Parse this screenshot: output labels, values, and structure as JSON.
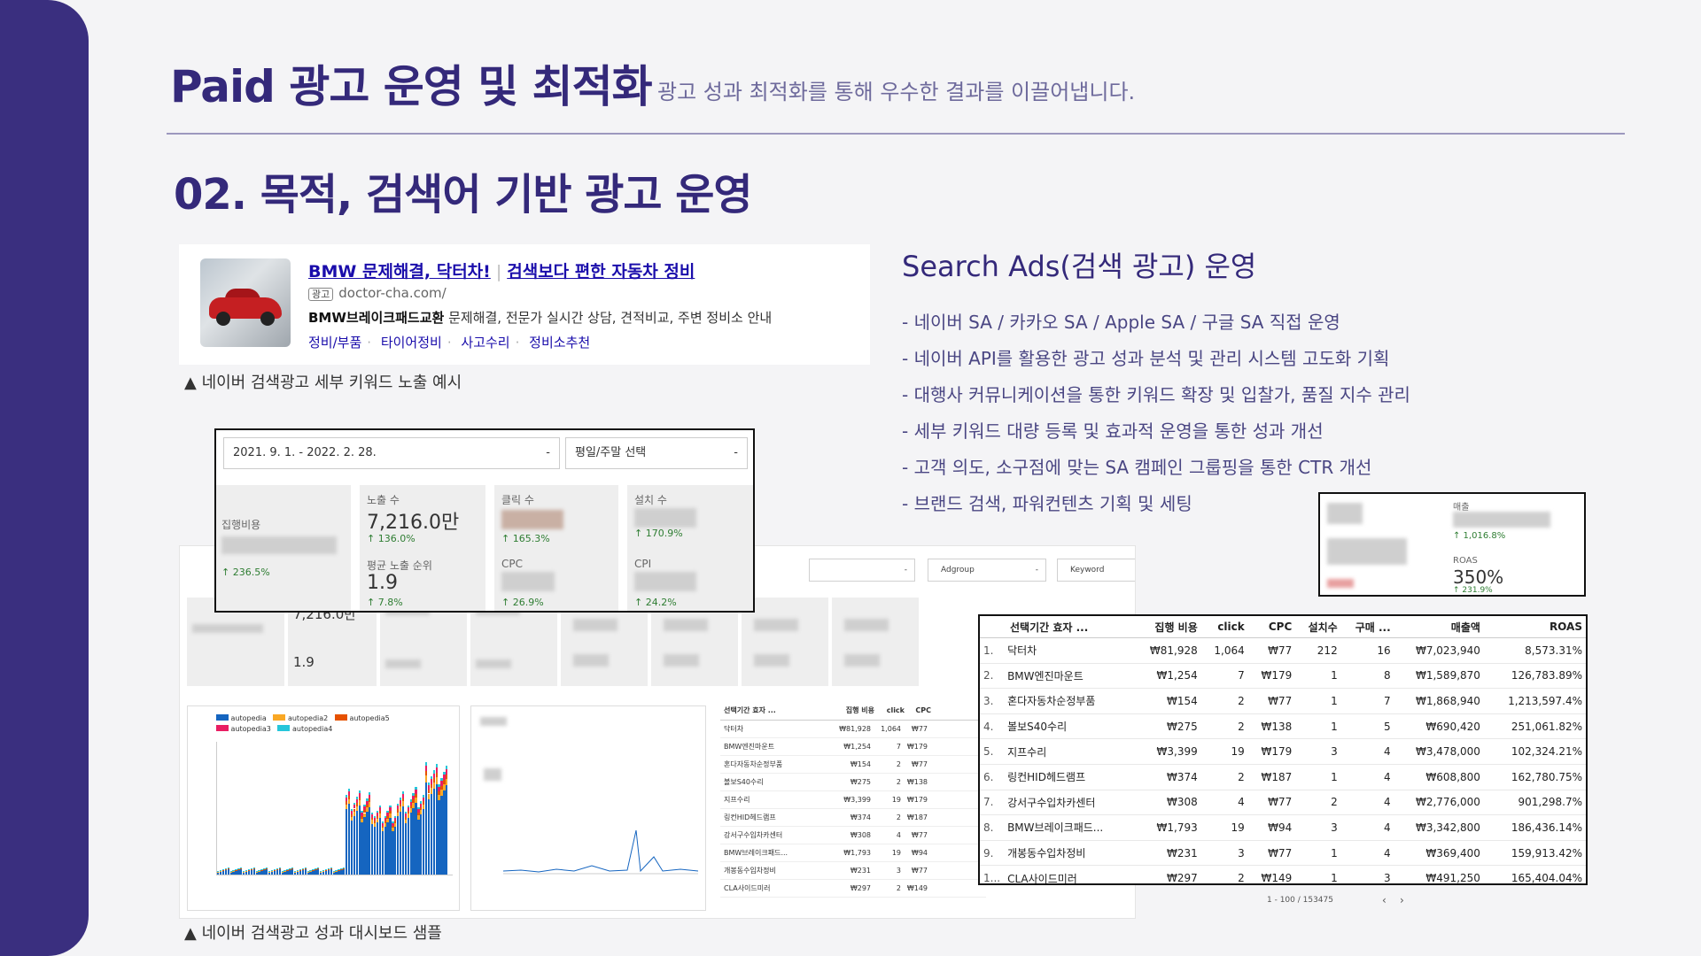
{
  "header": {
    "title": "Paid 광고 운영 및 최적화",
    "subtitle": "광고 성과 최적화를 통해 우수한 결과를 이끌어냅니다."
  },
  "section_title": "02. 목적, 검색어 기반 광고 운영",
  "ad_preview": {
    "title_main": "BMW 문제해결, 닥터차!",
    "title_sub": "검색보다 편한 자동차 정비",
    "ad_tag": "광고",
    "url": "doctor-cha.com/",
    "desc_bold": "BMW브레이크패드교환",
    "desc_rest": " 문제해결, 전문가 실시간 상담, 견적비교, 주변 정비소 안내",
    "links": [
      "정비/부품",
      "타이어정비",
      "사고수리",
      "정비소추천"
    ],
    "caption": "▲ 네이버 검색광고 세부 키워드 노출 예시"
  },
  "search_ads": {
    "heading": "Search Ads(검색 광고) 운영",
    "bullets": [
      "- 네이버 SA / 카카오 SA / Apple SA / 구글 SA 직접 운영",
      "- 네이버 API를 활용한 광고 성과 분석 및 관리 시스템 고도화 기획",
      "- 대행사 커뮤니케이션을 통한 키워드 확장 및 입찰가, 품질 지수 관리",
      "- 세부 키워드 대량 등록 및 효과적 운영을 통한 성과 개선",
      "- 고객 의도, 소구점에 맞는 SA 캠페인 그룹핑을 통한 CTR 개선",
      "- 브랜드 검색, 파워컨텐츠 기획 및 세팅"
    ]
  },
  "kpi_zoom": {
    "date_range": "2021. 9. 1. - 2022. 2. 28.",
    "weekday_select": "평일/주말 선택",
    "cost_label": "집행비용",
    "cost_change": "↑ 236.5%",
    "impr_label": "노출 수",
    "impr_value": "7,216.0만",
    "impr_change": "↑ 136.0%",
    "avg_rank_label": "평균 노출 순위",
    "avg_rank_value": "1.9",
    "avg_rank_change": "↑ 7.8%",
    "click_label": "클릭 수",
    "click_change": "↑ 165.3%",
    "cpc_label": "CPC",
    "cpc_change": "↑ 26.9%",
    "install_label": "설치 수",
    "install_change": "↑ 170.9%",
    "cpi_label": "CPI",
    "cpi_change": "↑ 24.2%"
  },
  "roas_zoom": {
    "sales_label": "매출",
    "sales_change": "↑ 1,016.8%",
    "roas_label": "ROAS",
    "roas_value": "350%",
    "roas_change": "↑ 231.9%"
  },
  "dashboard": {
    "filter_adgroup": "Adgroup",
    "filter_keyword": "Keyword",
    "legend": [
      "autopedia",
      "autopedia2",
      "autopedia5",
      "autopedia3",
      "autopedia4"
    ],
    "legend_colors": [
      "#1565c0",
      "#f9a825",
      "#e65100",
      "#e91e63",
      "#26c6da"
    ],
    "pagination": "1 - 100 / 153475",
    "caption": "▲ 네이버 검색광고 성과 대시보드 샘플",
    "mini_kpi_impr": "7,216.0만",
    "mini_kpi_rank": "1.9"
  },
  "keyword_table": {
    "headers": [
      "선택기간 효자 ...",
      "집행 비용",
      "click",
      "CPC",
      "설치수",
      "구매 ...",
      "매출액",
      "ROAS"
    ],
    "rows": [
      {
        "n": "1.",
        "kw": "닥터차",
        "cost": "₩81,928",
        "click": "1,064",
        "cpc": "₩77",
        "install": "212",
        "buy": "16",
        "sales": "₩7,023,940",
        "roas": "8,573.31%"
      },
      {
        "n": "2.",
        "kw": "BMW엔진마운트",
        "cost": "₩1,254",
        "click": "7",
        "cpc": "₩179",
        "install": "1",
        "buy": "8",
        "sales": "₩1,589,870",
        "roas": "126,783.89%"
      },
      {
        "n": "3.",
        "kw": "혼다자동차순정부품",
        "cost": "₩154",
        "click": "2",
        "cpc": "₩77",
        "install": "1",
        "buy": "7",
        "sales": "₩1,868,940",
        "roas": "1,213,597.4%"
      },
      {
        "n": "4.",
        "kw": "볼보S40수리",
        "cost": "₩275",
        "click": "2",
        "cpc": "₩138",
        "install": "1",
        "buy": "5",
        "sales": "₩690,420",
        "roas": "251,061.82%"
      },
      {
        "n": "5.",
        "kw": "지프수리",
        "cost": "₩3,399",
        "click": "19",
        "cpc": "₩179",
        "install": "3",
        "buy": "4",
        "sales": "₩3,478,000",
        "roas": "102,324.21%"
      },
      {
        "n": "6.",
        "kw": "링컨HID헤드램프",
        "cost": "₩374",
        "click": "2",
        "cpc": "₩187",
        "install": "1",
        "buy": "4",
        "sales": "₩608,800",
        "roas": "162,780.75%"
      },
      {
        "n": "7.",
        "kw": "강서구수입차카센터",
        "cost": "₩308",
        "click": "4",
        "cpc": "₩77",
        "install": "2",
        "buy": "4",
        "sales": "₩2,776,000",
        "roas": "901,298.7%"
      },
      {
        "n": "8.",
        "kw": "BMW브레이크패드...",
        "cost": "₩1,793",
        "click": "19",
        "cpc": "₩94",
        "install": "3",
        "buy": "4",
        "sales": "₩3,342,800",
        "roas": "186,436.14%"
      },
      {
        "n": "9.",
        "kw": "개봉동수입차정비",
        "cost": "₩231",
        "click": "3",
        "cpc": "₩77",
        "install": "1",
        "buy": "4",
        "sales": "₩369,400",
        "roas": "159,913.42%"
      },
      {
        "n": "1...",
        "kw": "CLA사이드미러",
        "cost": "₩297",
        "click": "2",
        "cpc": "₩149",
        "install": "1",
        "buy": "3",
        "sales": "₩491,250",
        "roas": "165,404.04%"
      }
    ]
  }
}
